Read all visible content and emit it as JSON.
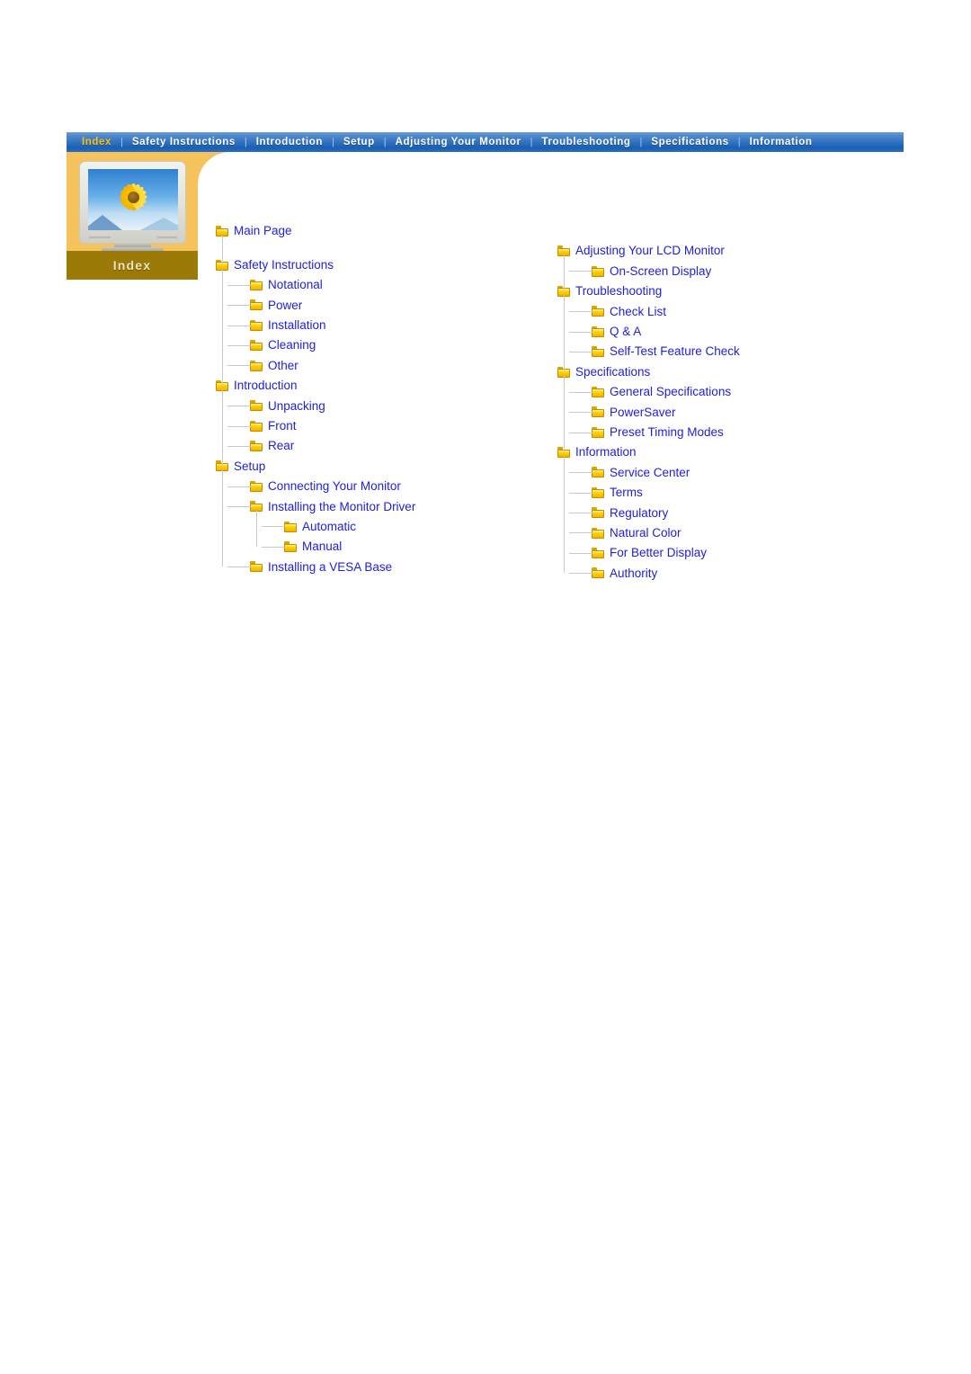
{
  "nav": {
    "separator": "|",
    "items": [
      {
        "label": "Index",
        "active": true
      },
      {
        "label": "Safety Instructions",
        "active": false
      },
      {
        "label": "Introduction",
        "active": false
      },
      {
        "label": "Setup",
        "active": false
      },
      {
        "label": "Adjusting Your Monitor",
        "active": false
      },
      {
        "label": "Troubleshooting",
        "active": false
      },
      {
        "label": "Specifications",
        "active": false
      },
      {
        "label": "Information",
        "active": false
      }
    ]
  },
  "index_panel": {
    "label": "Index",
    "image_alt": "monitor-sunflower-image"
  },
  "colors": {
    "nav_bar_blue": "#1a5fb4",
    "nav_active_text": "#ffc107",
    "panel_orange": "#f5c25b",
    "panel_label_bar": "#9c7a08",
    "link_blue": "#2020dd",
    "folder_yellow": "#ffd400",
    "tree_line_gray": "#c9c9c9"
  },
  "tree": {
    "left_column": [
      {
        "label": "Main Page",
        "level": 1,
        "icon": "folder-icon"
      },
      {
        "label": "Safety Instructions",
        "level": 1,
        "icon": "folder-icon"
      },
      {
        "label": "Notational",
        "level": 2,
        "icon": "folder-icon"
      },
      {
        "label": "Power",
        "level": 2,
        "icon": "folder-icon"
      },
      {
        "label": "Installation",
        "level": 2,
        "icon": "folder-icon"
      },
      {
        "label": "Cleaning",
        "level": 2,
        "icon": "folder-icon"
      },
      {
        "label": "Other",
        "level": 2,
        "icon": "folder-icon"
      },
      {
        "label": "Introduction",
        "level": 1,
        "icon": "folder-icon"
      },
      {
        "label": "Unpacking",
        "level": 2,
        "icon": "folder-icon"
      },
      {
        "label": "Front",
        "level": 2,
        "icon": "folder-icon"
      },
      {
        "label": "Rear",
        "level": 2,
        "icon": "folder-icon"
      },
      {
        "label": "Setup",
        "level": 1,
        "icon": "folder-icon"
      },
      {
        "label": "Connecting Your Monitor",
        "level": 2,
        "icon": "folder-icon"
      },
      {
        "label": "Installing the Monitor Driver",
        "level": 2,
        "icon": "folder-icon"
      },
      {
        "label": "Automatic",
        "level": 3,
        "icon": "folder-icon"
      },
      {
        "label": "Manual",
        "level": 3,
        "icon": "folder-icon"
      },
      {
        "label": "Installing a VESA Base",
        "level": 2,
        "icon": "folder-icon"
      }
    ],
    "right_column": [
      {
        "label": "Adjusting Your LCD Monitor",
        "level": 1,
        "icon": "folder-icon"
      },
      {
        "label": "On-Screen Display",
        "level": 2,
        "icon": "folder-icon"
      },
      {
        "label": "Troubleshooting",
        "level": 1,
        "icon": "folder-icon"
      },
      {
        "label": "Check List",
        "level": 2,
        "icon": "folder-icon"
      },
      {
        "label": "Q & A",
        "level": 2,
        "icon": "folder-icon"
      },
      {
        "label": "Self-Test Feature Check",
        "level": 2,
        "icon": "folder-icon"
      },
      {
        "label": "Specifications",
        "level": 1,
        "icon": "folder-icon"
      },
      {
        "label": "General Specifications",
        "level": 2,
        "icon": "folder-icon"
      },
      {
        "label": "PowerSaver",
        "level": 2,
        "icon": "folder-icon"
      },
      {
        "label": "Preset Timing Modes",
        "level": 2,
        "icon": "folder-icon"
      },
      {
        "label": "Information",
        "level": 1,
        "icon": "folder-icon"
      },
      {
        "label": "Service Center",
        "level": 2,
        "icon": "folder-icon"
      },
      {
        "label": "Terms",
        "level": 2,
        "icon": "folder-icon"
      },
      {
        "label": "Regulatory",
        "level": 2,
        "icon": "folder-icon"
      },
      {
        "label": "Natural Color",
        "level": 2,
        "icon": "folder-icon"
      },
      {
        "label": "For Better Display",
        "level": 2,
        "icon": "folder-icon"
      },
      {
        "label": "Authority",
        "level": 2,
        "icon": "folder-icon"
      }
    ]
  }
}
